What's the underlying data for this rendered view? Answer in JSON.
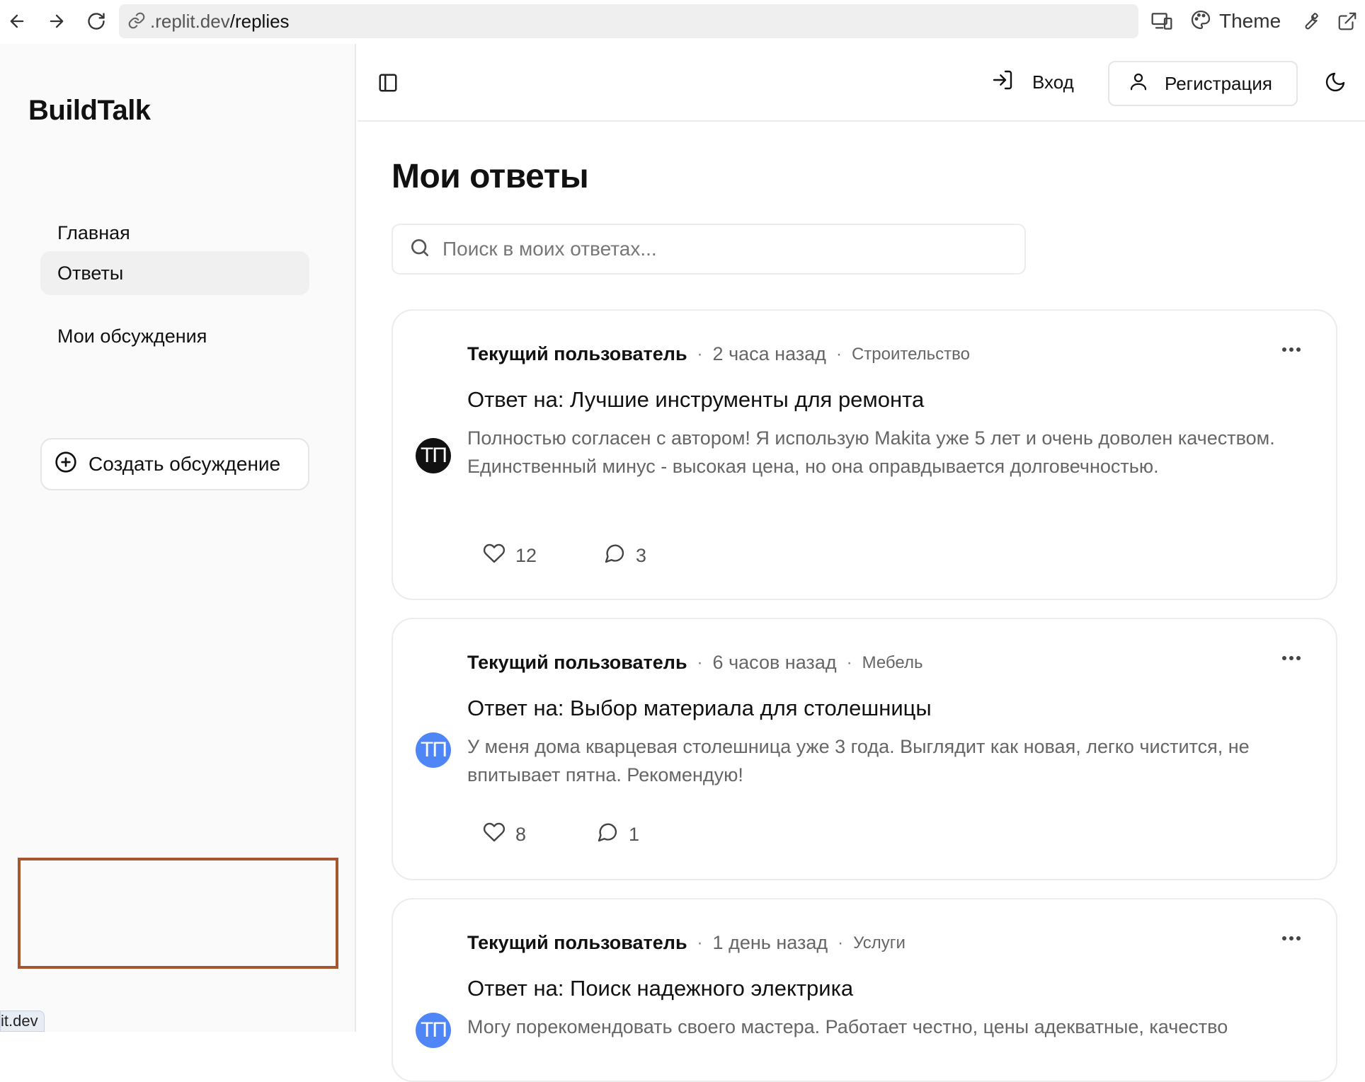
{
  "browser": {
    "url_host": ".replit.dev",
    "url_path": "/replies",
    "theme_label": "Theme"
  },
  "sidebar": {
    "brand": "BuildTalk",
    "items": [
      {
        "label": "Главная",
        "active": false
      },
      {
        "label": "Ответы",
        "active": true
      },
      {
        "label": "Мои обсуждения",
        "active": false
      }
    ],
    "create_label": "Создать обсуждение"
  },
  "status_bar": {
    "text": "it.dev"
  },
  "header": {
    "login_label": "Вход",
    "register_label": "Регистрация"
  },
  "main": {
    "title": "Мои ответы",
    "search": {
      "placeholder": "Поиск в моих ответах...",
      "value": ""
    }
  },
  "replies": [
    {
      "author": "Текущий пользователь",
      "time": "2 часа назад",
      "category": "Строительство",
      "title": "Ответ на: Лучшие инструменты для ремонта",
      "body": "Полностью согласен с автором! Я использую Makita уже 5 лет и очень доволен качеством. Единственный минус - высокая цена, но она оправдывается долговечностью.",
      "likes": "12",
      "comments": "3",
      "avatar_text": "ТП",
      "avatar_color": "#111111"
    },
    {
      "author": "Текущий пользователь",
      "time": "6 часов назад",
      "category": "Мебель",
      "title": "Ответ на: Выбор материала для столешницы",
      "body": "У меня дома кварцевая столешница уже 3 года. Выглядит как новая, легко чистится, не впитывает пятна. Рекомендую!",
      "likes": "8",
      "comments": "1",
      "avatar_text": "ТП",
      "avatar_color": "#4f86f7"
    },
    {
      "author": "Текущий пользователь",
      "time": "1 день назад",
      "category": "Услуги",
      "title": "Ответ на: Поиск надежного электрика",
      "body": "Могу порекомендовать своего мастера. Работает честно, цены адекватные, качество",
      "avatar_text": "ТП",
      "avatar_color": "#4f86f7"
    }
  ],
  "icons": [
    "back-arrow-icon",
    "forward-arrow-icon",
    "reload-icon",
    "link-icon",
    "devices-icon",
    "palette-icon",
    "wrench-icon",
    "external-link-icon",
    "sidebar-toggle-icon",
    "login-icon",
    "user-icon",
    "moon-icon",
    "search-icon",
    "plus-circle-icon",
    "more-icon",
    "heart-icon",
    "comment-icon"
  ]
}
